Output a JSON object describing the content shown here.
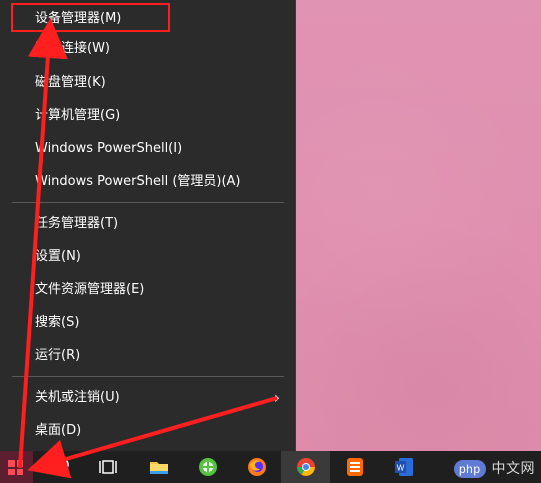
{
  "menu": {
    "items": [
      {
        "label": "设备管理器(M)"
      },
      {
        "label": "网络连接(W)"
      },
      {
        "label": "磁盘管理(K)"
      },
      {
        "label": "计算机管理(G)"
      },
      {
        "label": "Windows PowerShell(I)"
      },
      {
        "label": "Windows PowerShell (管理员)(A)"
      },
      {
        "label": "任务管理器(T)"
      },
      {
        "label": "设置(N)"
      },
      {
        "label": "文件资源管理器(E)"
      },
      {
        "label": "搜索(S)"
      },
      {
        "label": "运行(R)"
      },
      {
        "label": "关机或注销(U)"
      },
      {
        "label": "桌面(D)"
      }
    ],
    "submenu_arrow": "›"
  },
  "watermark": {
    "logo": "php",
    "text": "中文网"
  },
  "icons": {
    "start": "windows-logo-icon",
    "search": "search-icon",
    "task_view": "task-view-icon",
    "files": "folder-icon",
    "browser_360": "browser-360-icon",
    "firefox": "firefox-icon",
    "chrome": "chrome-icon",
    "app_orange": "orange-app-icon",
    "word": "word-icon"
  },
  "colors": {
    "menu_bg": "#2b2b2b",
    "menu_text": "#ffffff",
    "desktop": "#e08fb0",
    "taskbar": "#1f1f1f",
    "annotation_red": "#ff1f1f",
    "start_logo": "#ff4b57"
  }
}
